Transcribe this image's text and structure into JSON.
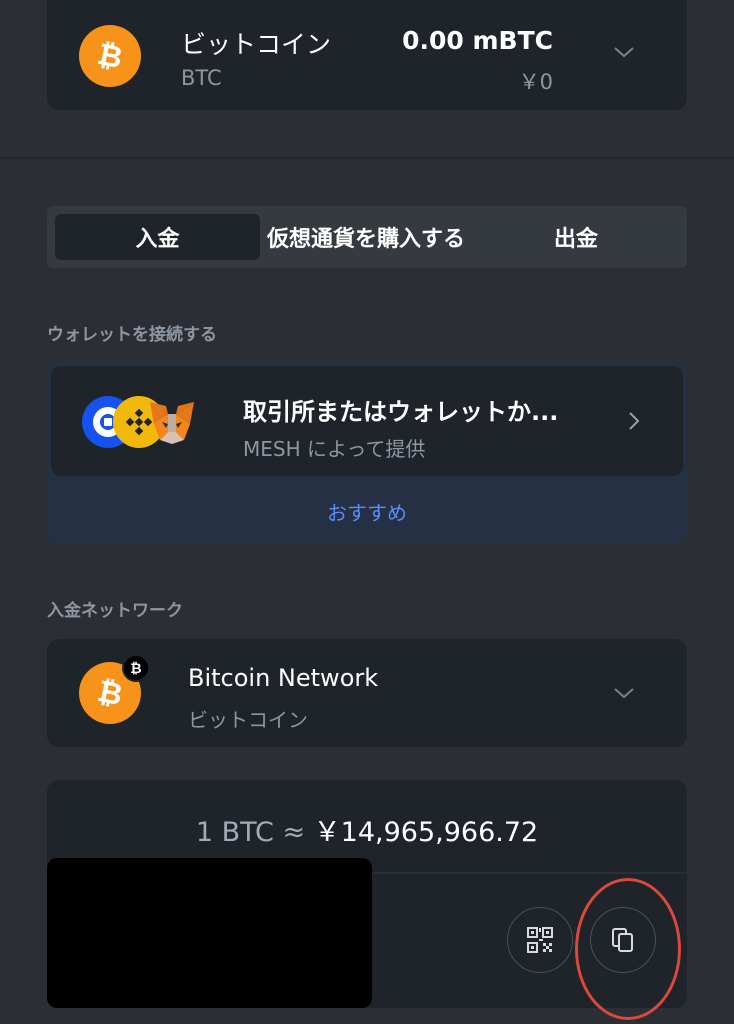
{
  "asset": {
    "name": "ビットコイン",
    "symbol": "BTC",
    "amount": "0.00 mBTC",
    "fiat": "￥0",
    "icon": "bitcoin-icon"
  },
  "tabs": [
    {
      "label": "入金",
      "active": true
    },
    {
      "label": "仮想通貨を購入する",
      "active": false
    },
    {
      "label": "出金",
      "active": false
    }
  ],
  "wallet_section": {
    "label": "ウォレットを接続する",
    "title": "取引所またはウォレットか...",
    "subtitle": "MESH によって提供",
    "recommend": "おすすめ",
    "icons": [
      "coinbase-icon",
      "binance-icon",
      "metamask-icon"
    ]
  },
  "network_section": {
    "label": "入金ネットワーク",
    "name": "Bitcoin Network",
    "subtitle": "ビットコイン",
    "badge_symbol": "₿"
  },
  "rate": {
    "prefix": "1 BTC ≈ ",
    "value": "￥14,965,966.72"
  },
  "colors": {
    "background": "#2b2f35",
    "card": "#1f232a",
    "bitcoin": "#f7931a",
    "accent_blue": "#5a8df5",
    "annotation_red": "#d9493d"
  }
}
